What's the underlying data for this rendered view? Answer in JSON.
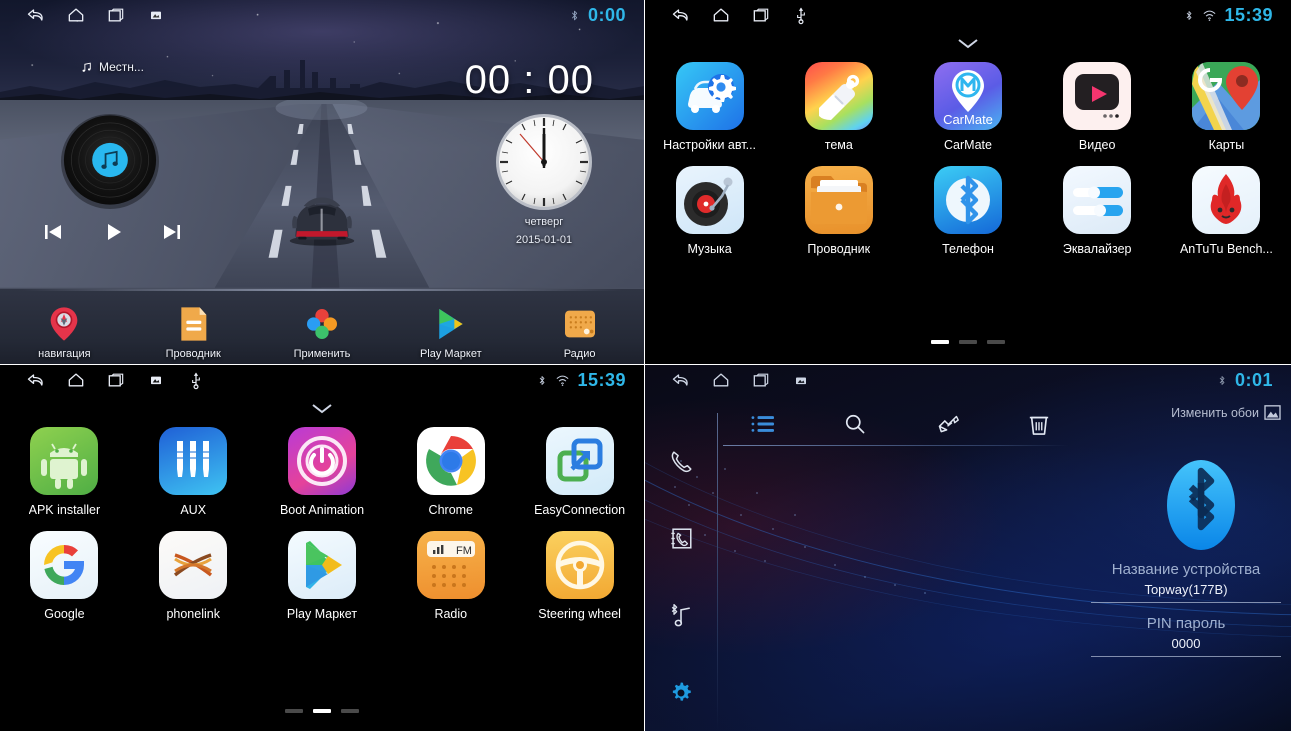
{
  "panels": {
    "home": {
      "name": "car-launcher-home",
      "statusbar": {
        "back_icon": "back-icon",
        "home_icon": "home-icon",
        "recents_icon": "recents-icon",
        "screenshot_icon": "screenshot-icon",
        "bluetooth_icon": "bluetooth-icon",
        "time": "0:00"
      },
      "now_playing": {
        "icon": "music-note-icon",
        "title": "Местн..."
      },
      "media_controls": {
        "prev": "previous-track-icon",
        "play": "play-icon",
        "next": "next-track-icon"
      },
      "big_clock": "00 : 00",
      "weekday": "четверг",
      "date": "2015-01-01",
      "dock": [
        {
          "label": "навигация",
          "icon": "navigation-pin-icon"
        },
        {
          "label": "Проводник",
          "icon": "file-manager-icon"
        },
        {
          "label": "Применить",
          "icon": "apply-petals-icon"
        },
        {
          "label": "Play Маркет",
          "icon": "play-store-icon"
        },
        {
          "label": "Радио",
          "icon": "radio-icon"
        }
      ]
    },
    "drawer1": {
      "name": "app-drawer-page-1",
      "statusbar": {
        "back_icon": "back-icon",
        "home_icon": "home-icon",
        "recents_icon": "recents-icon",
        "usb_icon": "usb-icon",
        "bluetooth_icon": "bluetooth-icon",
        "wifi_icon": "wifi-icon",
        "time": "15:39"
      },
      "collapse_icon": "chevron-down-icon",
      "apps": [
        {
          "label": "Настройки авт...",
          "icon": "car-settings-icon"
        },
        {
          "label": "тема",
          "icon": "theme-brush-icon"
        },
        {
          "label": "CarMate",
          "icon": "carmate-icon"
        },
        {
          "label": "Видео",
          "icon": "video-player-icon"
        },
        {
          "label": "Карты",
          "icon": "google-maps-icon"
        },
        {
          "label": "Музыка",
          "icon": "music-turntable-icon"
        },
        {
          "label": "Проводник",
          "icon": "file-manager-icon"
        },
        {
          "label": "Телефон",
          "icon": "bluetooth-phone-icon"
        },
        {
          "label": "Эквалайзер",
          "icon": "equalizer-icon"
        },
        {
          "label": "AnTuTu Bench...",
          "icon": "antutu-icon"
        }
      ],
      "pages": 3,
      "active_page": 1
    },
    "drawer2": {
      "name": "app-drawer-page-2",
      "statusbar": {
        "back_icon": "back-icon",
        "home_icon": "home-icon",
        "recents_icon": "recents-icon",
        "screenshot_icon": "screenshot-icon",
        "usb_icon": "usb-icon",
        "bluetooth_icon": "bluetooth-icon",
        "wifi_icon": "wifi-icon",
        "time": "15:39"
      },
      "collapse_icon": "chevron-down-icon",
      "apps": [
        {
          "label": "APK installer",
          "icon": "android-robot-icon"
        },
        {
          "label": "AUX",
          "icon": "aux-jack-icon"
        },
        {
          "label": "Boot Animation",
          "icon": "power-boot-icon"
        },
        {
          "label": "Chrome",
          "icon": "chrome-icon"
        },
        {
          "label": "EasyConnection",
          "icon": "easyconnection-icon"
        },
        {
          "label": "Google",
          "icon": "google-g-icon"
        },
        {
          "label": "phonelink",
          "icon": "phonelink-icon"
        },
        {
          "label": "Play Маркет",
          "icon": "play-store-icon"
        },
        {
          "label": "Radio",
          "icon": "fm-radio-icon"
        },
        {
          "label": "Steering wheel",
          "icon": "steering-wheel-icon"
        }
      ],
      "pages": 3,
      "active_page": 2
    },
    "bluetooth": {
      "name": "bluetooth-settings",
      "statusbar": {
        "back_icon": "back-icon",
        "home_icon": "home-icon",
        "recents_icon": "recents-icon",
        "screenshot_icon": "screenshot-icon",
        "bluetooth_icon": "bluetooth-icon",
        "time": "0:01"
      },
      "sidebar": [
        {
          "icon": "phone-dialer-icon",
          "name": "dialer"
        },
        {
          "icon": "contacts-book-icon",
          "name": "contacts"
        },
        {
          "icon": "bluetooth-music-icon",
          "name": "bt-music"
        },
        {
          "icon": "gear-icon",
          "name": "settings",
          "active": true
        }
      ],
      "toolbar": [
        {
          "icon": "list-icon",
          "name": "device-list",
          "active": true
        },
        {
          "icon": "search-icon",
          "name": "search-devices"
        },
        {
          "icon": "pair-hand-icon",
          "name": "pair-device"
        },
        {
          "icon": "trash-icon",
          "name": "delete-device"
        }
      ],
      "wallpaper_button": {
        "label": "Изменить обои",
        "icon": "image-icon"
      },
      "logo_icon": "bluetooth-logo-icon",
      "fields": [
        {
          "label": "Название устройства",
          "value": "Topway(177B)"
        },
        {
          "label": "PIN пароль",
          "value": "0000"
        }
      ]
    }
  },
  "colors": {
    "accent_cyan": "#2fb7e8",
    "bt_blue": "#29a9f5",
    "gear_blue": "#1e9be0",
    "panel_bg": "#000000"
  }
}
